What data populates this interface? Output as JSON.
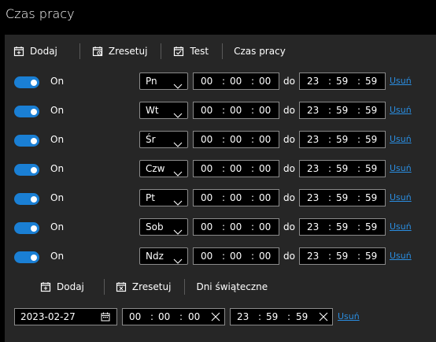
{
  "window": {
    "title": "Czas pracy"
  },
  "toolbar_top": {
    "add": "Dodaj",
    "reset": "Zresetuj",
    "test": "Test",
    "section": "Czas pracy"
  },
  "days": [
    {
      "on": "On",
      "day": "Pn",
      "from": [
        "00",
        "00",
        "00"
      ],
      "to": [
        "23",
        "59",
        "59"
      ],
      "do": "do",
      "remove": "Usuń"
    },
    {
      "on": "On",
      "day": "Wt",
      "from": [
        "00",
        "00",
        "00"
      ],
      "to": [
        "23",
        "59",
        "59"
      ],
      "do": "do",
      "remove": "Usuń"
    },
    {
      "on": "On",
      "day": "Śr",
      "from": [
        "00",
        "00",
        "00"
      ],
      "to": [
        "23",
        "59",
        "59"
      ],
      "do": "do",
      "remove": "Usuń"
    },
    {
      "on": "On",
      "day": "Czw",
      "from": [
        "00",
        "00",
        "00"
      ],
      "to": [
        "23",
        "59",
        "59"
      ],
      "do": "do",
      "remove": "Usuń"
    },
    {
      "on": "On",
      "day": "Pt",
      "from": [
        "00",
        "00",
        "00"
      ],
      "to": [
        "23",
        "59",
        "59"
      ],
      "do": "do",
      "remove": "Usuń"
    },
    {
      "on": "On",
      "day": "Sob",
      "from": [
        "00",
        "00",
        "00"
      ],
      "to": [
        "23",
        "59",
        "59"
      ],
      "do": "do",
      "remove": "Usuń"
    },
    {
      "on": "On",
      "day": "Ndz",
      "from": [
        "00",
        "00",
        "00"
      ],
      "to": [
        "23",
        "59",
        "59"
      ],
      "do": "do",
      "remove": "Usuń"
    }
  ],
  "toolbar_bottom": {
    "add": "Dodaj",
    "reset": "Zresetuj",
    "section": "Dni świąteczne"
  },
  "holiday": {
    "date": "2023-02-27",
    "from": [
      "00",
      "00",
      "00"
    ],
    "to": [
      "23",
      "59",
      "59"
    ],
    "remove": "Usuń"
  },
  "colors": {
    "accent": "#1a7fd4",
    "link": "#2a8de0",
    "panel": "#262626"
  },
  "icons": [
    "calendar-add-icon",
    "calendar-reset-icon",
    "calendar-check-icon",
    "chevron-down-icon",
    "calendar-icon",
    "clear-icon"
  ]
}
